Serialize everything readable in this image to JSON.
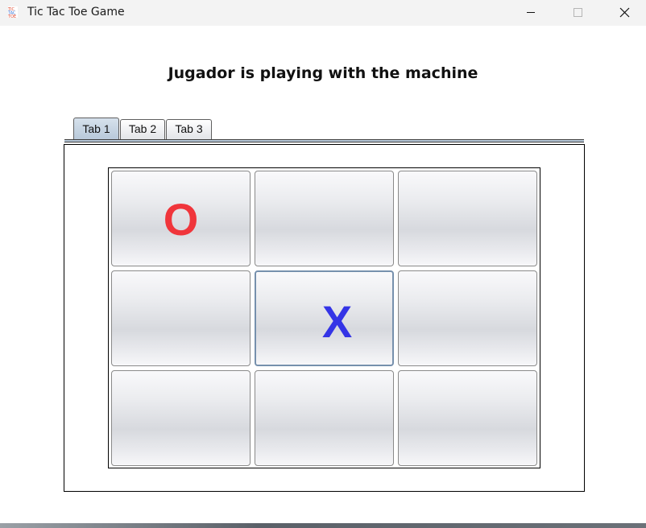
{
  "window": {
    "title": "Tic Tac Toe Game"
  },
  "header": {
    "text": "Jugador is playing with the machine"
  },
  "tabs": [
    {
      "label": "Tab 1",
      "selected": true
    },
    {
      "label": "Tab 2",
      "selected": false
    },
    {
      "label": "Tab 3",
      "selected": false
    }
  ],
  "board": {
    "cells": [
      "O",
      "",
      "",
      "",
      "X",
      "",
      "",
      "",
      ""
    ],
    "focused_cell": 4
  },
  "colors": {
    "o_mark": "#f0353b",
    "x_mark": "#3434e6",
    "selected_tab": "#b7c8d9",
    "focus_border": "#7690ad"
  }
}
